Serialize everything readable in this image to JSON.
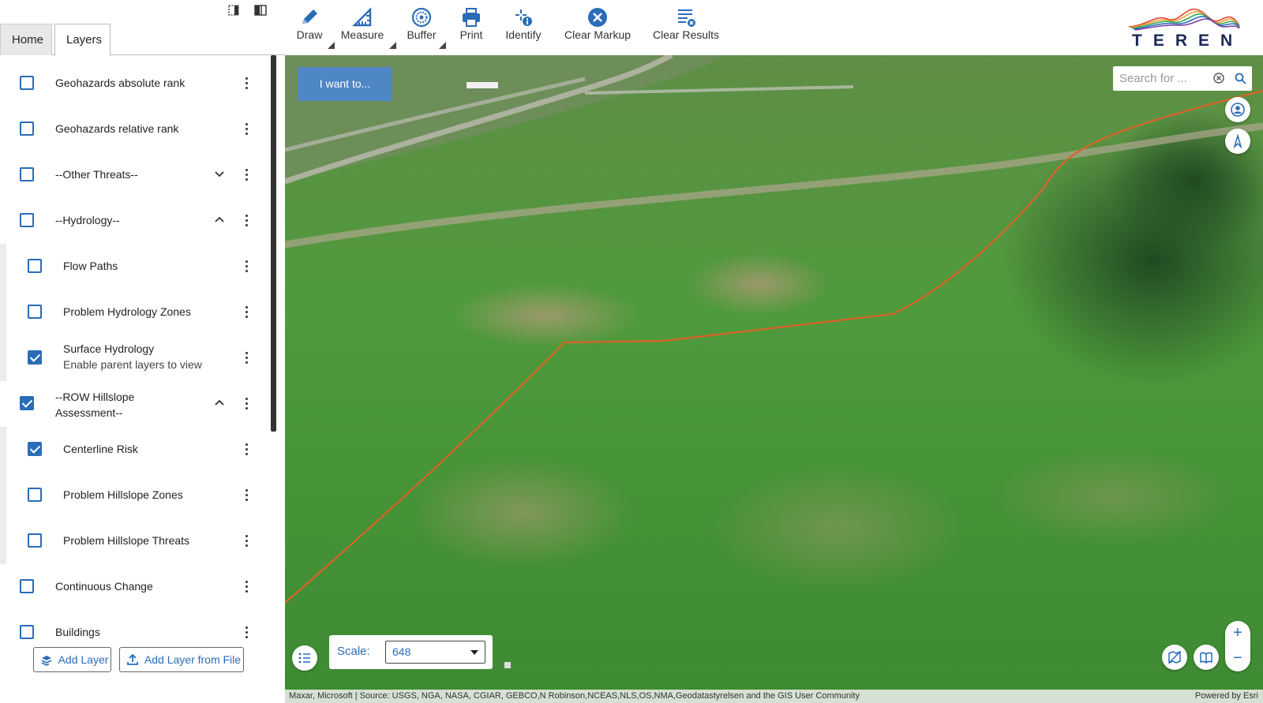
{
  "panel": {
    "tabs": [
      {
        "label": "Home"
      },
      {
        "label": "Layers"
      }
    ],
    "side_nub": "t",
    "layers": [
      {
        "name": "Geohazards absolute rank",
        "checked": false
      },
      {
        "name": "Geohazards relative rank",
        "checked": false
      },
      {
        "name": "--Other Threats--",
        "checked": false,
        "chevron": "down"
      },
      {
        "name": "--Hydrology--",
        "checked": false,
        "chevron": "up"
      },
      {
        "name": "Flow Paths",
        "checked": false,
        "child": true
      },
      {
        "name": "Problem Hydrology Zones",
        "checked": false,
        "child": true
      },
      {
        "name": "Surface Hydrology",
        "sub": "Enable parent layers to view",
        "checked": true,
        "child": true
      },
      {
        "name": "--ROW Hillslope Assessment--",
        "checked": true,
        "chevron": "up"
      },
      {
        "name": "Centerline Risk",
        "checked": true,
        "child": true
      },
      {
        "name": "Problem Hillslope Zones",
        "checked": false,
        "child": true
      },
      {
        "name": "Problem Hillslope Threats",
        "checked": false,
        "child": true
      },
      {
        "name": "Continuous Change",
        "checked": false
      },
      {
        "name": "Buildings",
        "checked": false
      }
    ],
    "add_layer_label": "Add Layer",
    "add_layer_file_label": "Add Layer from File"
  },
  "toolbar": {
    "tools": [
      {
        "label": "Draw",
        "icon": "pencil-icon"
      },
      {
        "label": "Measure",
        "icon": "ruler-icon"
      },
      {
        "label": "Buffer",
        "icon": "buffer-icon"
      },
      {
        "label": "Print",
        "icon": "printer-icon"
      },
      {
        "label": "Identify",
        "icon": "identify-icon"
      },
      {
        "label": "Clear Markup",
        "icon": "close-circle-icon"
      },
      {
        "label": "Clear Results",
        "icon": "clear-results-icon"
      }
    ]
  },
  "brand": {
    "name": "TEREN",
    "accent": "#2a6cb8"
  },
  "map": {
    "i_want_label": "I want to...",
    "search_placeholder": "Search for ...",
    "scale_label": "Scale:",
    "scale_value": "648",
    "attribution": "Maxar, Microsoft | Source: USGS, NGA, NASA, CGIAR, GEBCO,N Robinson,NCEAS,NLS,OS,NMA,Geodatastyrelsen and the GIS User Community",
    "powered_by": "Powered by Esri",
    "zoom_in": "+",
    "zoom_out": "−"
  }
}
